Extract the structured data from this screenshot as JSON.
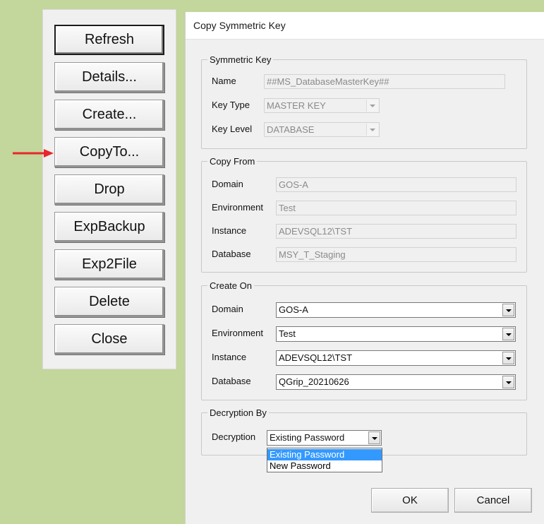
{
  "side_buttons": {
    "refresh": "Refresh",
    "details": "Details...",
    "create": "Create...",
    "copyto": "CopyTo...",
    "drop": "Drop",
    "expbackup": "ExpBackup",
    "exp2file": "Exp2File",
    "delete": "Delete",
    "close": "Close"
  },
  "annotation": {
    "arrow_color": "#e8262a",
    "points_to": "CopyTo..."
  },
  "dialog": {
    "title": "Copy Symmetric Key",
    "symmetric_key": {
      "legend": "Symmetric Key",
      "name_label": "Name",
      "name_value": "##MS_DatabaseMasterKey##",
      "key_type_label": "Key Type",
      "key_type_value": "MASTER KEY",
      "key_level_label": "Key Level",
      "key_level_value": "DATABASE"
    },
    "copy_from": {
      "legend": "Copy From",
      "domain_label": "Domain",
      "domain_value": "GOS-A",
      "environment_label": "Environment",
      "environment_value": "Test",
      "instance_label": "Instance",
      "instance_value": "ADEVSQL12\\TST",
      "database_label": "Database",
      "database_value": "MSY_T_Staging"
    },
    "create_on": {
      "legend": "Create On",
      "domain_label": "Domain",
      "domain_value": "GOS-A",
      "environment_label": "Environment",
      "environment_value": "Test",
      "instance_label": "Instance",
      "instance_value": "ADEVSQL12\\TST",
      "database_label": "Database",
      "database_value": "QGrip_20210626"
    },
    "decryption_by": {
      "legend": "Decryption By",
      "decryption_label": "Decryption",
      "selected_value": "Existing Password",
      "options": [
        "Existing Password",
        "New Password"
      ]
    },
    "ok_label": "OK",
    "cancel_label": "Cancel"
  },
  "colors": {
    "background": "#c3d69b",
    "panel": "#f0f0f0",
    "selection": "#3399ff"
  }
}
